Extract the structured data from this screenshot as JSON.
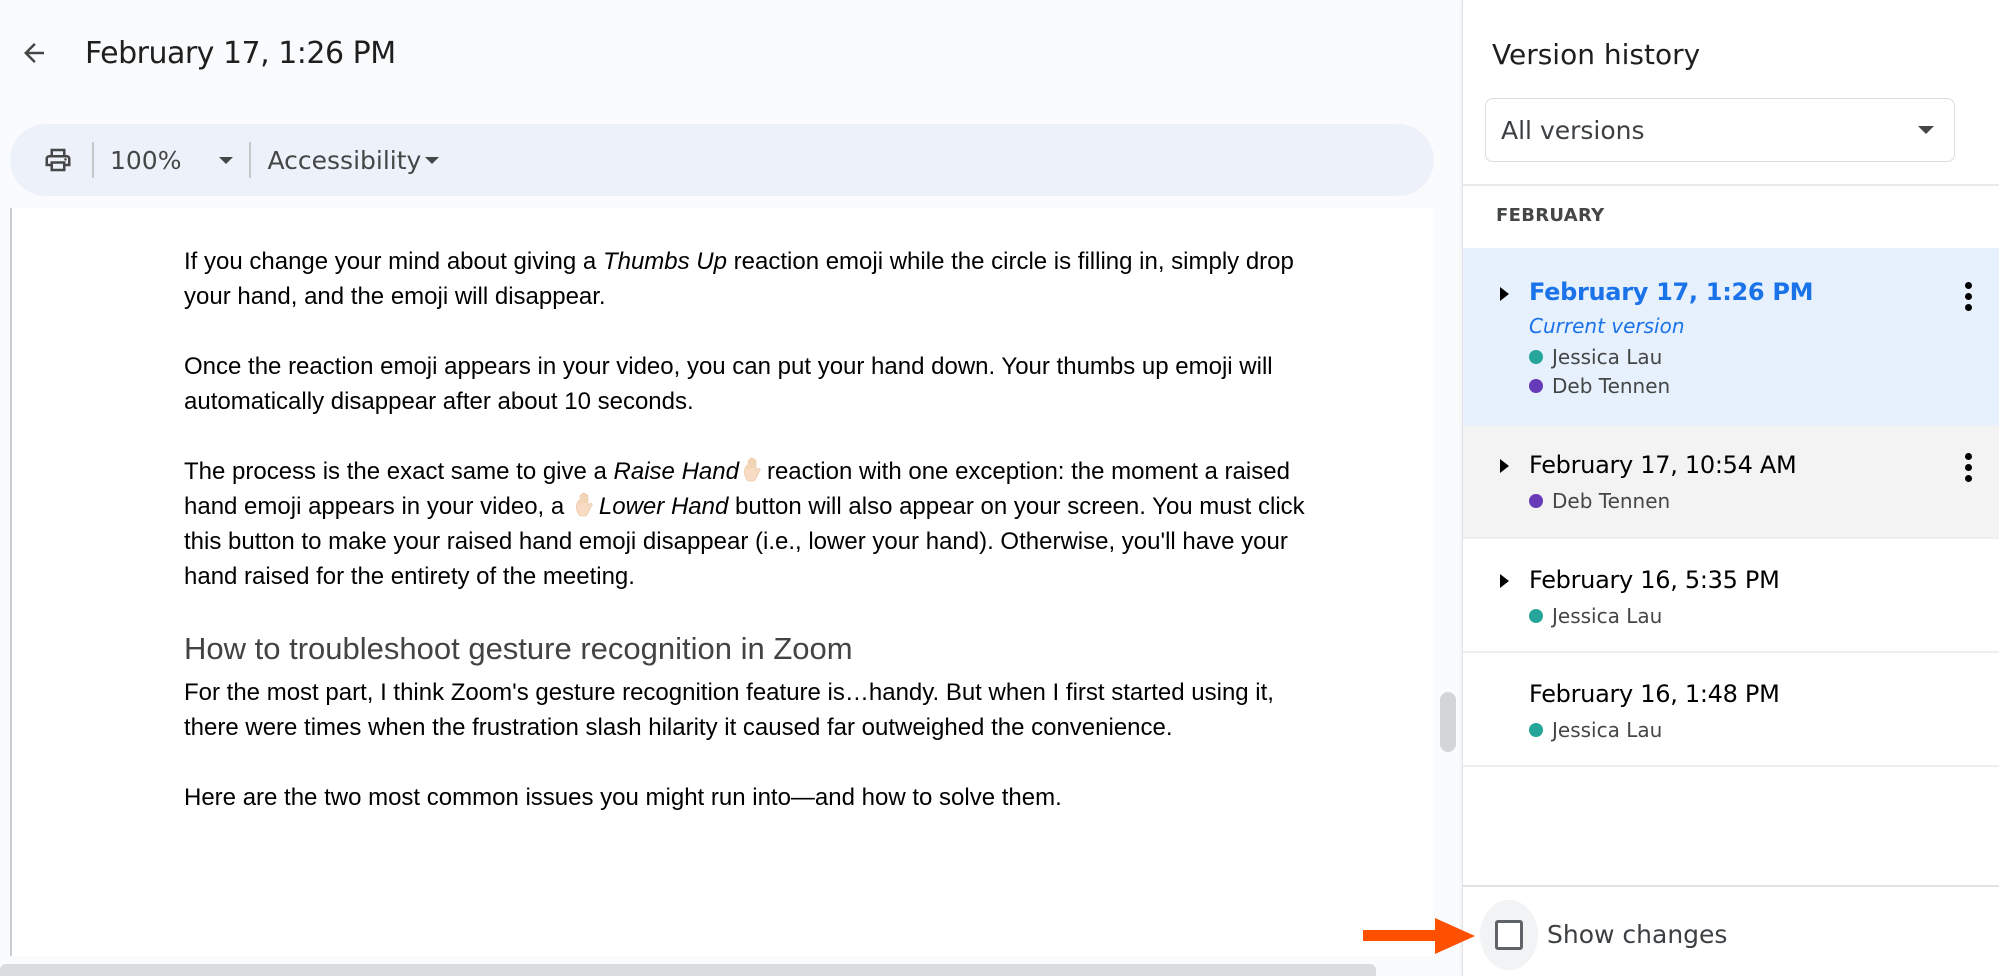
{
  "header": {
    "back_label": "Back",
    "title": "February 17, 1:26 PM"
  },
  "toolbar": {
    "print_icon": "printer-icon",
    "zoom_value": "100%",
    "accessibility_label": "Accessibility"
  },
  "document": {
    "paragraphs": [
      {
        "parts": [
          "If you change your mind about giving a ",
          "Thumbs Up",
          " reaction emoji while the circle is filling in, simply drop your hand, and the emoji will disappear."
        ]
      },
      {
        "text": "Once the reaction emoji appears in your video, you can put your hand down. Your thumbs up emoji will automatically disappear after about 10 seconds."
      },
      {
        "parts": [
          "The process is the exact same to give a ",
          "Raise Hand",
          "reaction with one exception: the moment a raised hand emoji appears in your video, a ",
          "Lower Hand",
          " button will also appear on your screen. You must click this button to make your raised hand emoji disappear (i.e., lower your hand). Otherwise, you'll have your hand raised for the entirety of the meeting."
        ],
        "emoji": "raised-hand-emoji"
      }
    ],
    "heading": "How to troubleshoot gesture recognition in Zoom",
    "paragraphs_after": [
      "For the most part, I think Zoom's gesture recognition feature is…handy. But when I first started using it, there were times when the frustration slash hilarity it caused far outweighed the convenience.",
      "Here are the two most common issues you might run into—and how to solve them."
    ]
  },
  "version_panel": {
    "title": "Version history",
    "filter": {
      "selected": "All versions"
    },
    "month": "FEBRUARY",
    "versions": [
      {
        "date": "February 17, 1:26 PM",
        "current_label": "Current version",
        "selected": true,
        "expandable": true,
        "has_menu": true,
        "authors": [
          {
            "name": "Jessica Lau",
            "color": "#26a69a"
          },
          {
            "name": "Deb Tennen",
            "color": "#673ab7"
          }
        ]
      },
      {
        "date": "February 17, 10:54 AM",
        "expandable": true,
        "has_menu": true,
        "authors": [
          {
            "name": "Deb Tennen",
            "color": "#673ab7"
          }
        ]
      },
      {
        "date": "February 16, 5:35 PM",
        "expandable": true,
        "has_menu": false,
        "authors": [
          {
            "name": "Jessica Lau",
            "color": "#26a69a"
          }
        ]
      },
      {
        "date": "February 16, 1:48 PM",
        "expandable": false,
        "has_menu": false,
        "authors": [
          {
            "name": "Jessica Lau",
            "color": "#26a69a"
          }
        ]
      }
    ],
    "show_changes": {
      "label": "Show changes",
      "checked": false
    }
  },
  "annotation": {
    "arrow_color": "#ff4f00"
  },
  "colors": {
    "accent": "#1a73e8",
    "selected_bg": "#e7f0fd",
    "toolbar_bg": "#edf2fa"
  }
}
